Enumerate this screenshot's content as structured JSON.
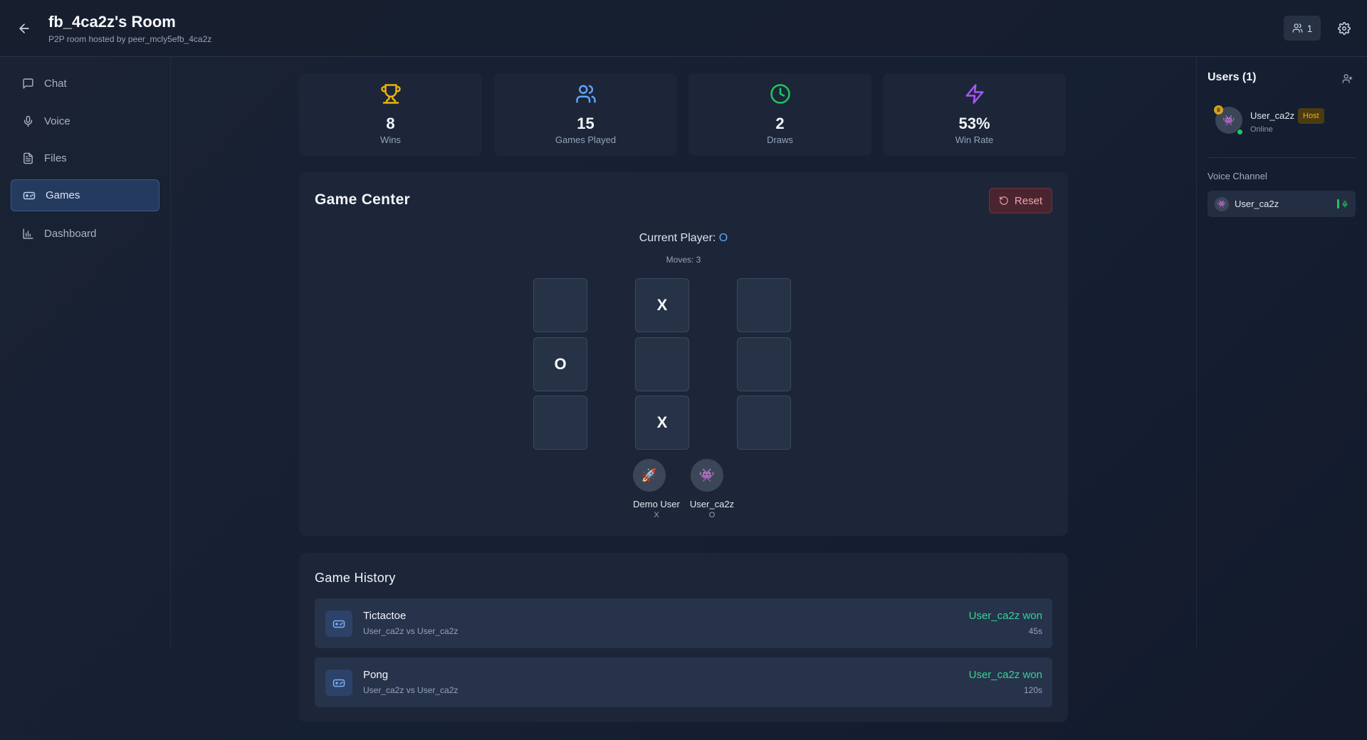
{
  "header": {
    "title": "fb_4ca2z's Room",
    "subtitle": "P2P room hosted by peer_mcly5efb_4ca2z",
    "user_count": "1"
  },
  "sidebar": {
    "items": [
      {
        "label": "Chat",
        "icon": "chat-icon"
      },
      {
        "label": "Voice",
        "icon": "mic-icon"
      },
      {
        "label": "Files",
        "icon": "file-icon"
      },
      {
        "label": "Games",
        "icon": "gamepad-icon",
        "active": true
      },
      {
        "label": "Dashboard",
        "icon": "bar-chart-icon"
      }
    ]
  },
  "stats": [
    {
      "value": "8",
      "label": "Wins",
      "icon": "trophy-icon",
      "color": "#eab308"
    },
    {
      "value": "15",
      "label": "Games Played",
      "icon": "users-icon",
      "color": "#60a5fa"
    },
    {
      "value": "2",
      "label": "Draws",
      "icon": "clock-icon",
      "color": "#22c55e"
    },
    {
      "value": "53%",
      "label": "Win Rate",
      "icon": "bolt-icon",
      "color": "#a855f7"
    }
  ],
  "game_center": {
    "title": "Game Center",
    "reset_label": "Reset",
    "current_player_label": "Current Player:",
    "current_player_symbol": "O",
    "moves_text": "Moves: 3",
    "board": [
      "",
      "X",
      "",
      "O",
      "",
      "",
      "",
      "X",
      ""
    ],
    "players": [
      {
        "name": "Demo User",
        "symbol": "X",
        "avatar": "🚀"
      },
      {
        "name": "User_ca2z",
        "symbol": "O",
        "avatar": "👾"
      }
    ]
  },
  "history": {
    "title": "Game History",
    "items": [
      {
        "game": "Tictactoe",
        "players": "User_ca2z vs User_ca2z",
        "result": "User_ca2z won",
        "duration": "45s"
      },
      {
        "game": "Pong",
        "players": "User_ca2z vs User_ca2z",
        "result": "User_ca2z won",
        "duration": "120s"
      }
    ]
  },
  "users_panel": {
    "title": "Users (1)",
    "user": {
      "name": "User_ca2z",
      "badge": "Host",
      "status": "Online",
      "avatar": "👾"
    },
    "voice_label": "Voice Channel",
    "voice_user": {
      "name": "User_ca2z",
      "avatar": "👾"
    }
  },
  "colors": {
    "accent": "#60a5fa",
    "win": "#34d399",
    "danger": "#f0a4a8",
    "online": "#22c55e"
  }
}
